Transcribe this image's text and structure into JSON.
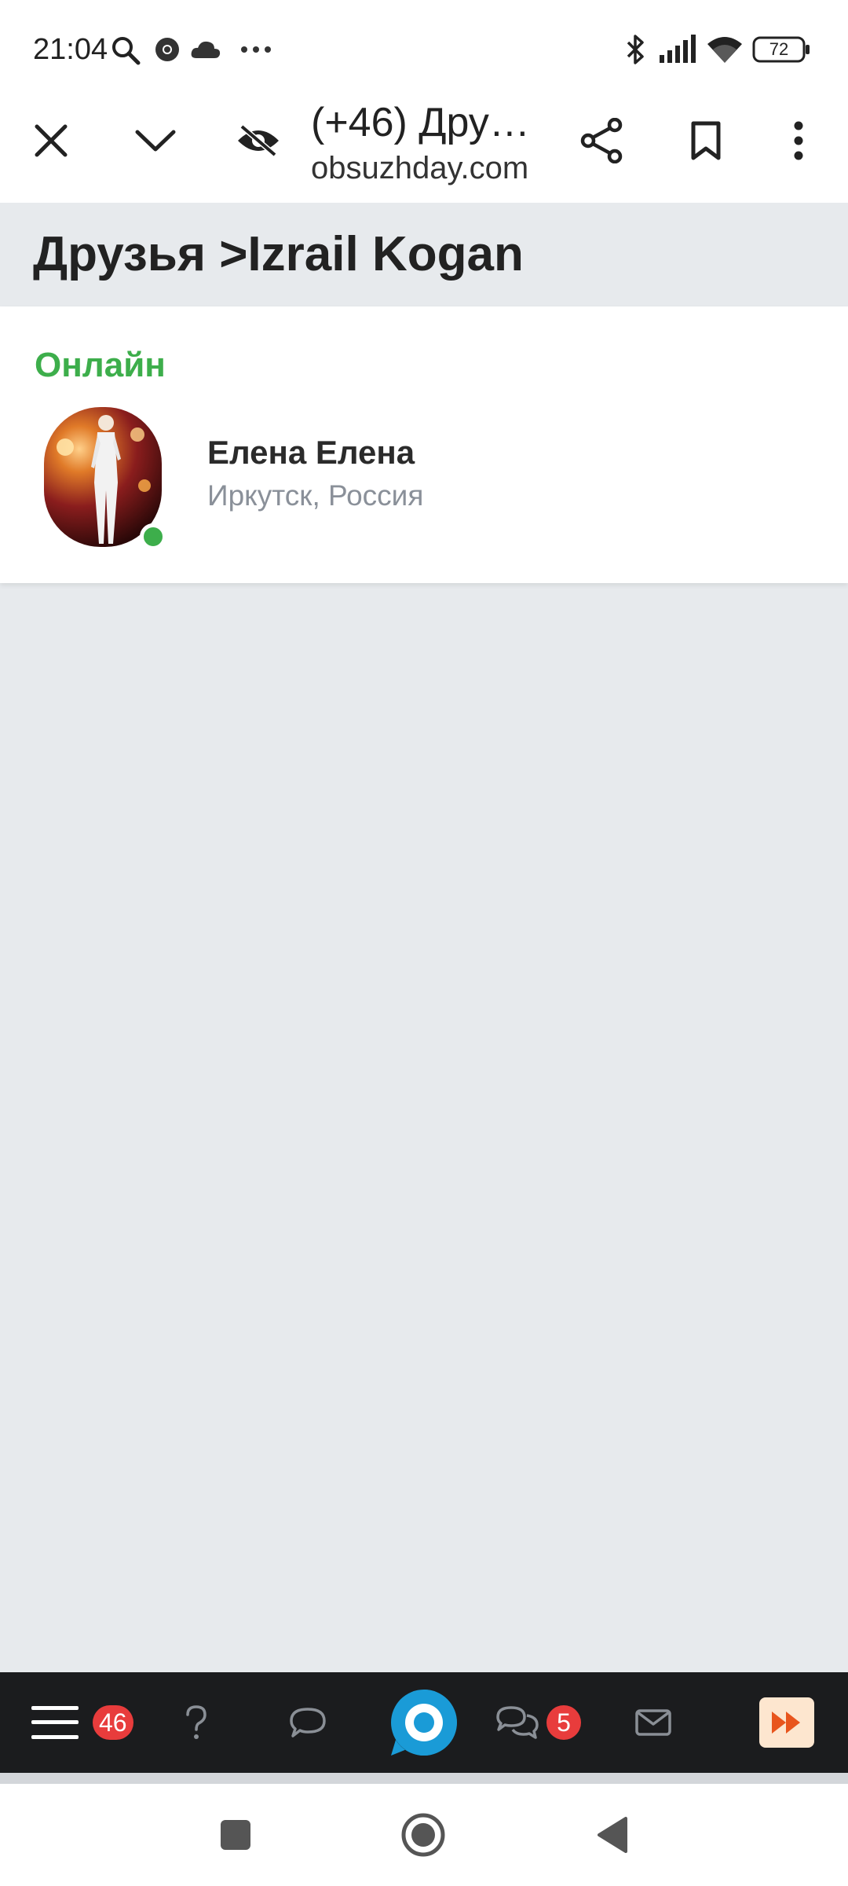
{
  "status_bar": {
    "time": "21:04",
    "battery": "72",
    "icons": [
      "search-icon",
      "chrome-icon",
      "cloud-icon",
      "more-dots-icon",
      "bluetooth-icon",
      "signal-icon",
      "wifi-icon",
      "battery-icon"
    ]
  },
  "browser": {
    "title": "(+46) Дру…",
    "url": "obsuzhday.com",
    "icons": [
      "close-icon",
      "chevron-down-icon",
      "eye-off-icon",
      "share-icon",
      "bookmark-icon",
      "more-vert-icon"
    ]
  },
  "page": {
    "title": "Друзья >Izrail Kogan",
    "section_label": "Онлайн",
    "friends": [
      {
        "name": "Елена Елена",
        "location": "Иркутск, Россия",
        "online": true
      }
    ]
  },
  "bottom_nav": {
    "menu_badge": "46",
    "chats_badge": "5",
    "icons": [
      "menu-icon",
      "question-icon",
      "comment-icon",
      "home-logo-icon",
      "chats-icon",
      "mail-icon",
      "fast-forward-icon"
    ]
  },
  "colors": {
    "online_green": "#3dae4b",
    "badge_red": "#e83c3c",
    "logo_blue": "#1a9bd7",
    "page_bg": "#e7eaed",
    "nav_bg": "#1b1c1e"
  }
}
